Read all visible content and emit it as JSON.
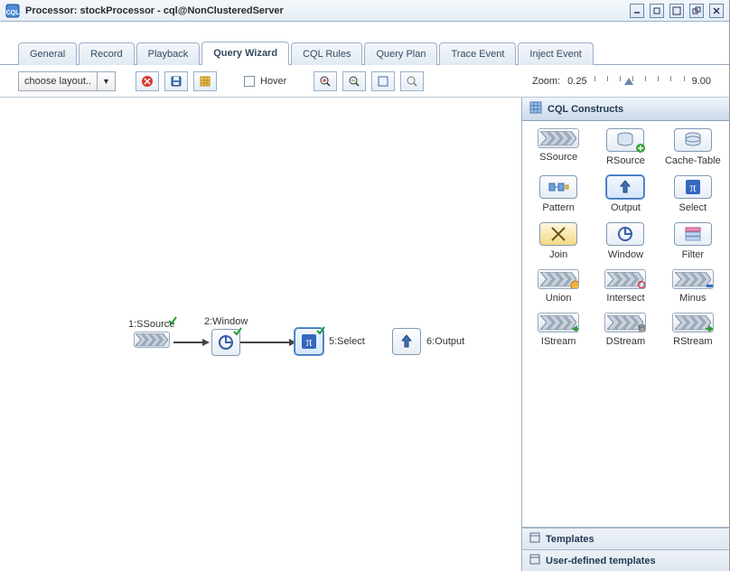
{
  "titlebar": {
    "title": "Processor: stockProcessor - cql@NonClusteredServer"
  },
  "tabs": [
    {
      "label": "General",
      "active": false
    },
    {
      "label": "Record",
      "active": false
    },
    {
      "label": "Playback",
      "active": false
    },
    {
      "label": "Query Wizard",
      "active": true
    },
    {
      "label": "CQL Rules",
      "active": false
    },
    {
      "label": "Query Plan",
      "active": false
    },
    {
      "label": "Trace Event",
      "active": false
    },
    {
      "label": "Inject Event",
      "active": false
    }
  ],
  "toolbar": {
    "layout_label": "choose layout..",
    "hover_label": "Hover",
    "zoom_label": "Zoom:",
    "zoom_min": "0.25",
    "zoom_max": "9.00"
  },
  "canvas": {
    "nodes": {
      "ssource": {
        "label": "1:SSource"
      },
      "window": {
        "label": "2:Window"
      },
      "select": {
        "label": "5:Select"
      },
      "output": {
        "label": "6:Output"
      }
    }
  },
  "palette": {
    "header": "CQL Constructs",
    "items": [
      {
        "id": "ssource",
        "label": "SSource"
      },
      {
        "id": "rsource",
        "label": "RSource"
      },
      {
        "id": "cache-table",
        "label": "Cache-Table"
      },
      {
        "id": "pattern",
        "label": "Pattern"
      },
      {
        "id": "output",
        "label": "Output",
        "selected": true
      },
      {
        "id": "select",
        "label": "Select"
      },
      {
        "id": "join",
        "label": "Join"
      },
      {
        "id": "window",
        "label": "Window"
      },
      {
        "id": "filter",
        "label": "Filter"
      },
      {
        "id": "union",
        "label": "Union"
      },
      {
        "id": "intersect",
        "label": "Intersect"
      },
      {
        "id": "minus",
        "label": "Minus"
      },
      {
        "id": "istream",
        "label": "IStream"
      },
      {
        "id": "dstream",
        "label": "DStream"
      },
      {
        "id": "rstream",
        "label": "RStream"
      }
    ],
    "footer1": "Templates",
    "footer2": "User-defined templates"
  }
}
